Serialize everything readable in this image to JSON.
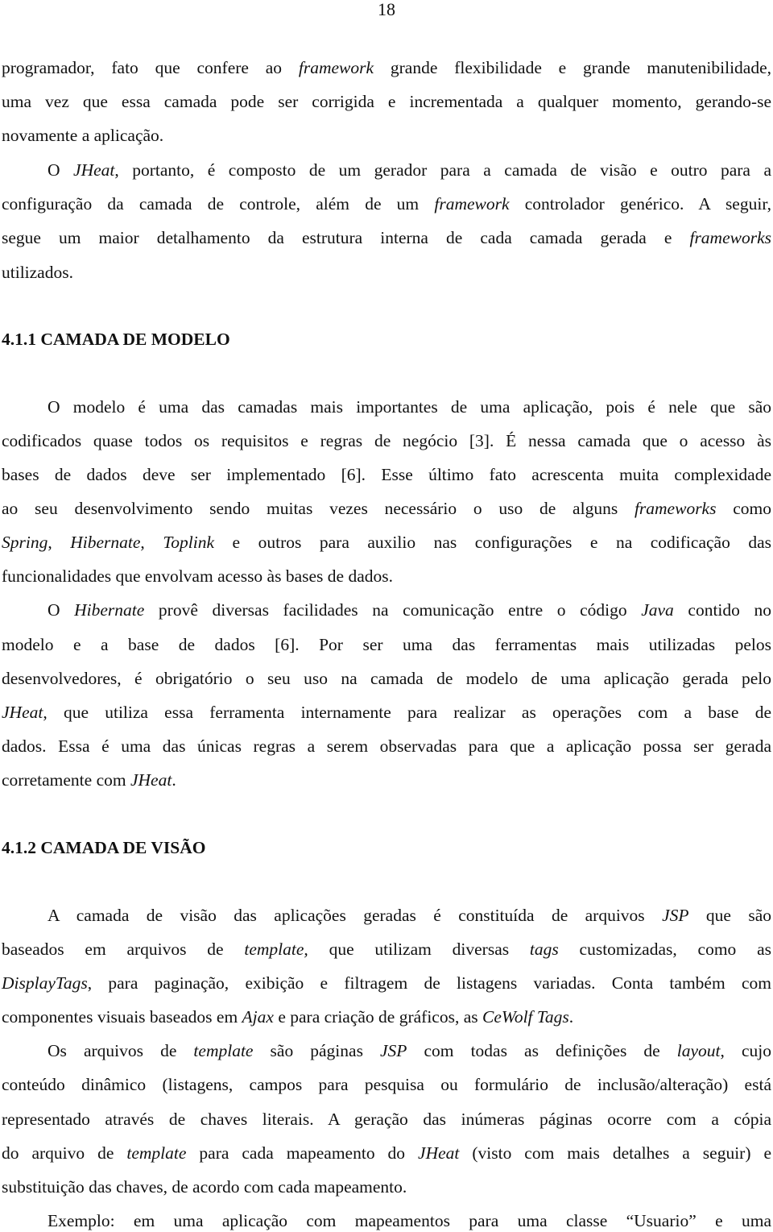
{
  "page_number": "18",
  "blocks": {
    "p1": [
      [
        "programador, fato que confere ao ",
        {
          "i": "framework"
        },
        " grande flexibilidade e grande manutenibilidade,"
      ],
      [
        "uma vez que essa camada pode ser corrigida e incrementada a qualquer momento, gerando-se"
      ],
      [
        "novamente a aplicação."
      ]
    ],
    "p2": [
      [
        "O ",
        {
          "i": "JHeat"
        },
        ", portanto, é composto de um gerador para a camada de visão e outro para a"
      ],
      [
        "configuração da camada de controle, além de um ",
        {
          "i": "framework"
        },
        " controlador genérico. A seguir,"
      ],
      [
        "segue um maior detalhamento da estrutura interna de cada camada gerada e ",
        {
          "i": "frameworks"
        }
      ],
      [
        "utilizados."
      ]
    ],
    "heading1": "4.1.1 CAMADA DE MODELO",
    "p3": [
      [
        "O modelo é uma das camadas mais importantes de uma aplicação, pois é nele que são"
      ],
      [
        "codificados quase todos os requisitos e regras de negócio [3]. É nessa camada que o acesso às"
      ],
      [
        "bases de dados deve ser implementado [6]. Esse último fato acrescenta muita complexidade"
      ],
      [
        "ao seu desenvolvimento sendo muitas vezes necessário o uso de alguns ",
        {
          "i": "frameworks"
        },
        " como"
      ],
      [
        {
          "i": "Spring"
        },
        ", ",
        {
          "i": "Hibernate"
        },
        ", ",
        {
          "i": "Toplink"
        },
        " e outros para auxilio nas configurações e na codificação das"
      ],
      [
        "funcionalidades que envolvam acesso às bases de dados."
      ]
    ],
    "p4": [
      [
        "O ",
        {
          "i": "Hibernate"
        },
        " provê diversas facilidades na comunicação entre o código ",
        {
          "i": "Java"
        },
        " contido no"
      ],
      [
        "modelo e a base de dados [6]. Por ser uma das ferramentas mais utilizadas pelos"
      ],
      [
        "desenvolvedores, é obrigatório o seu uso na camada de modelo de uma aplicação gerada pelo"
      ],
      [
        {
          "i": "JHeat"
        },
        ", que utiliza essa ferramenta internamente para realizar as operações com a base de"
      ],
      [
        "dados. Essa é uma das únicas regras a serem observadas para que a aplicação possa ser gerada"
      ],
      [
        "corretamente com ",
        {
          "i": "JHeat"
        },
        "."
      ]
    ],
    "heading2": "4.1.2 CAMADA DE VISÃO",
    "p5": [
      [
        "A camada de visão das aplicações geradas é constituída de arquivos ",
        {
          "i": "JSP"
        },
        " que são"
      ],
      [
        "baseados em arquivos de ",
        {
          "i": "template,"
        },
        " que utilizam diversas ",
        {
          "i": "tags"
        },
        " customizadas, como as"
      ],
      [
        {
          "i": "DisplayTags"
        },
        ", para paginação, exibição e filtragem de listagens variadas. Conta também com"
      ],
      [
        "componentes visuais baseados em ",
        {
          "i": "Ajax"
        },
        " e para criação de gráficos, as ",
        {
          "i": "CeWolf Tags"
        },
        "."
      ]
    ],
    "p6": [
      [
        "Os arquivos de ",
        {
          "i": "template"
        },
        " são páginas ",
        {
          "i": "JSP"
        },
        " com todas as definições de ",
        {
          "i": "layout"
        },
        ", cujo"
      ],
      [
        "conteúdo dinâmico (listagens, campos para pesquisa ou formulário de inclusão/alteração) está"
      ],
      [
        "representado através de chaves literais. A geração das inúmeras páginas ocorre com a cópia"
      ],
      [
        "do arquivo de ",
        {
          "i": "template"
        },
        " para cada mapeamento do ",
        {
          "i": "JHeat"
        },
        " (visto com mais detalhes a seguir) e"
      ],
      [
        "substituição das chaves, de acordo com cada mapeamento."
      ]
    ],
    "p7": [
      [
        "Exemplo: em uma aplicação com mapeamentos para uma classe “Usuario” e uma"
      ]
    ]
  }
}
